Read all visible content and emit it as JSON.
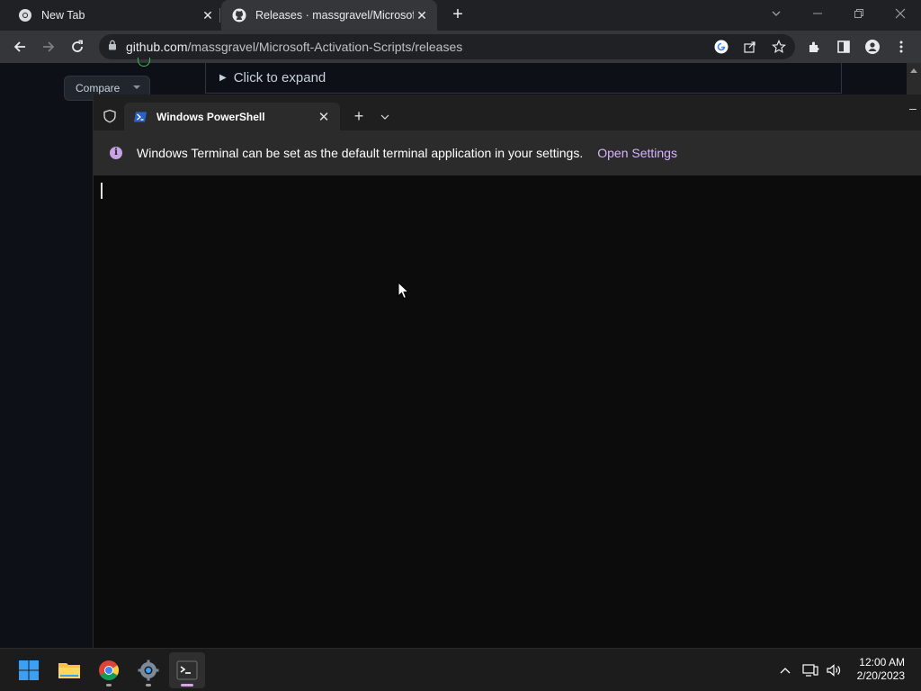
{
  "browser": {
    "tabs": [
      {
        "title": "New Tab",
        "icon": "chrome-icon"
      },
      {
        "title": "Releases · massgravel/Microsoft-",
        "icon": "github-icon",
        "active": true
      }
    ],
    "url_host": "github.com",
    "url_path": "/massgravel/Microsoft-Activation-Scripts/releases"
  },
  "github": {
    "compare_label": "Compare",
    "expand_label": "Click to expand"
  },
  "terminal": {
    "tab_title": "Windows PowerShell",
    "info_message": "Windows Terminal can be set as the default terminal application in your settings.",
    "info_link": "Open Settings",
    "colors": {
      "accent": "#d8b4fe",
      "background": "#0c0c0c"
    }
  },
  "taskbar": {
    "apps": [
      "windows-start-icon",
      "file-explorer-icon",
      "chrome-icon",
      "settings-icon",
      "terminal-icon"
    ],
    "time": "12:00 AM",
    "date": "2/20/2023"
  }
}
